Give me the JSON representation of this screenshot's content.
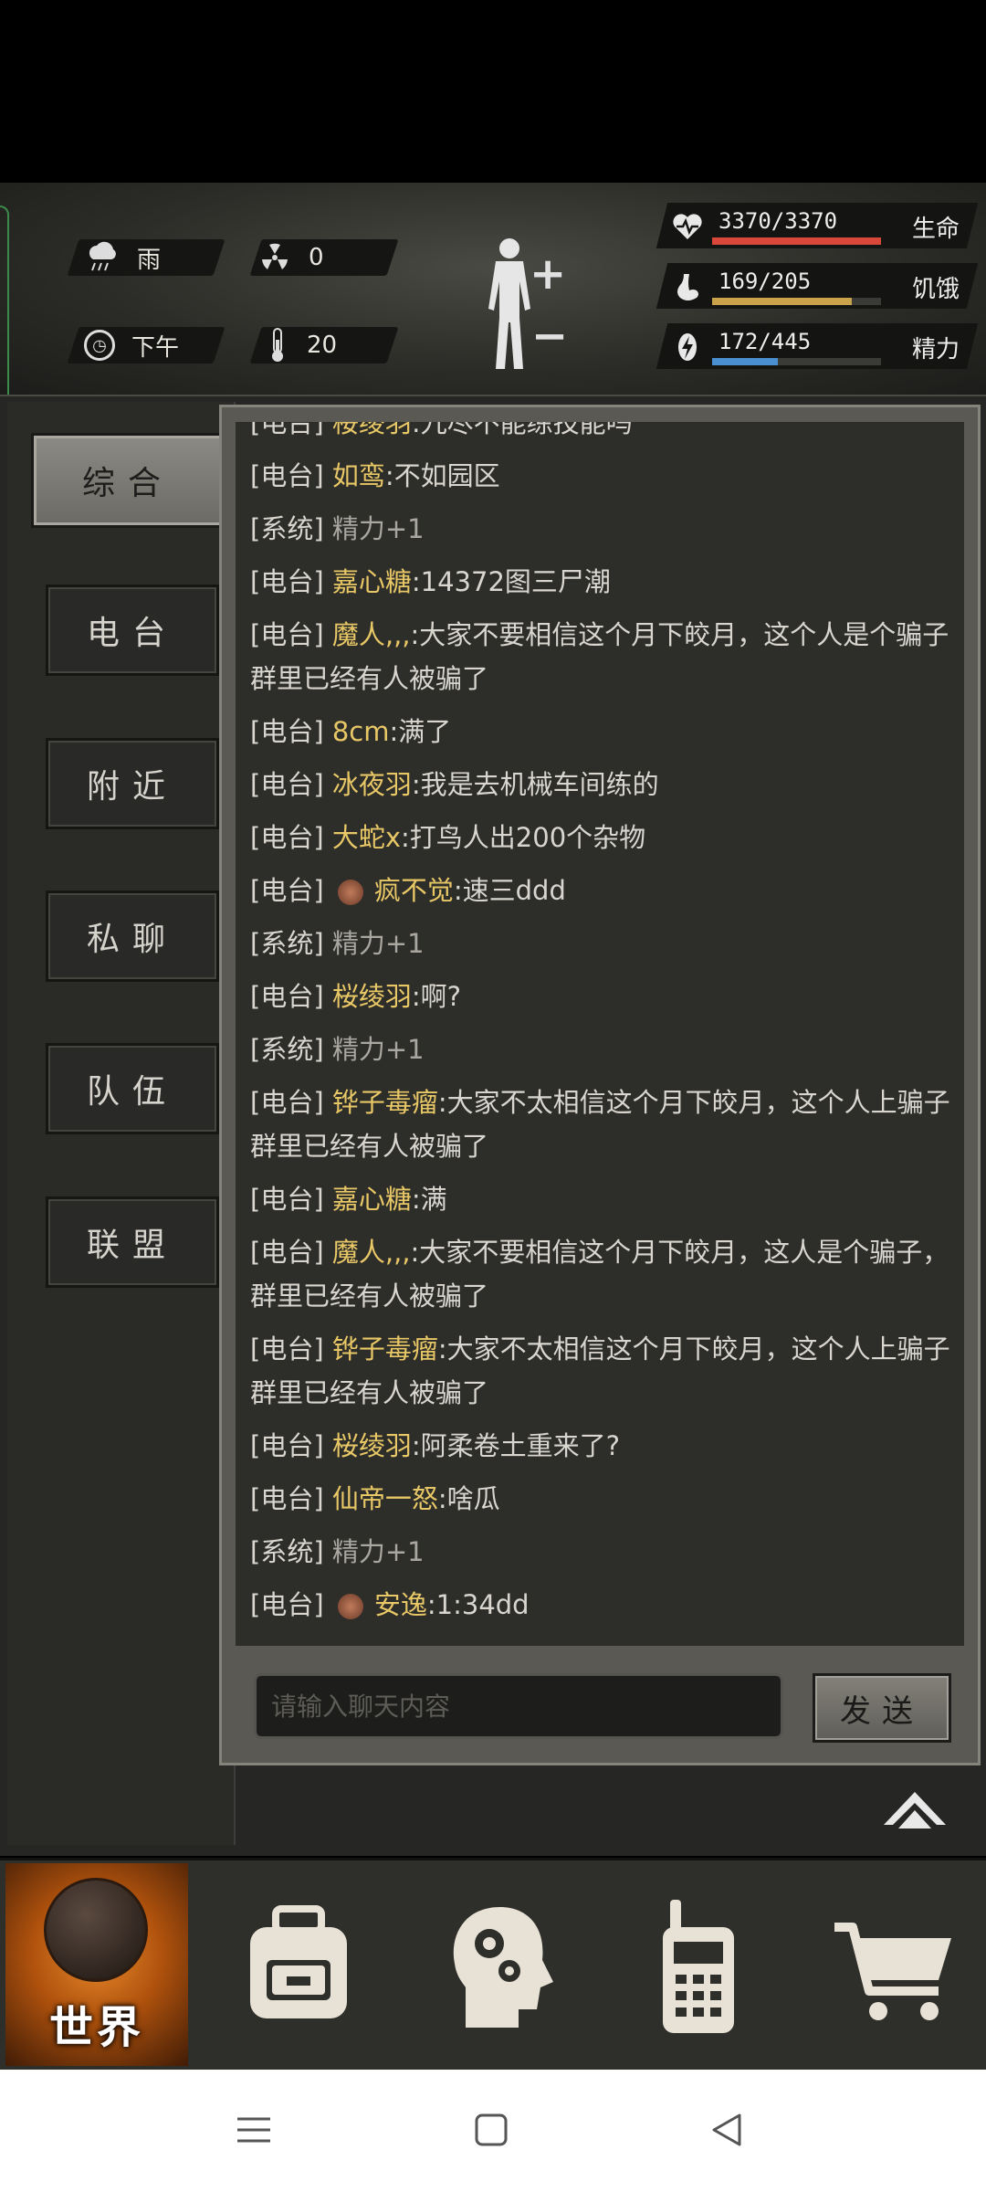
{
  "hud": {
    "weather": {
      "icon": "rain-cloud-icon",
      "label": "雨"
    },
    "radiation": {
      "icon": "radiation-icon",
      "value": "0"
    },
    "time": {
      "icon": "clock-icon",
      "label": "下午"
    },
    "temperature": {
      "icon": "thermometer-icon",
      "value": "20"
    },
    "stats": [
      {
        "name": "生命",
        "value": "3370/3370",
        "current": 3370,
        "max": 3370,
        "color": "#d9473a",
        "icon": "heart-pulse-icon"
      },
      {
        "name": "饥饿",
        "value": "169/205",
        "current": 169,
        "max": 205,
        "color": "#c9a24a",
        "icon": "stomach-icon"
      },
      {
        "name": "精力",
        "value": "172/445",
        "current": 172,
        "max": 445,
        "color": "#4a8fd0",
        "icon": "energy-bolt-icon"
      }
    ]
  },
  "tabs": [
    "综合",
    "电台",
    "附近",
    "私聊",
    "队伍",
    "联盟"
  ],
  "active_tab": "综合",
  "messages": [
    {
      "tag": "[电台]",
      "name": "桜绫羽",
      "text": ":九尽不能练技能吗"
    },
    {
      "tag": "[电台]",
      "name": "如鸾",
      "text": ":不如园区"
    },
    {
      "tag": "[系统]",
      "name": "",
      "text": "精力+1",
      "system": true
    },
    {
      "tag": "[电台]",
      "name": "嘉心糖",
      "text": ":14372图三尸潮"
    },
    {
      "tag": "[电台]",
      "name": "魔人,,,",
      "text": ":大家不要相信这个月下皎月，这个人是个骗子群里已经有人被骗了"
    },
    {
      "tag": "[电台]",
      "name": "8cm",
      "text": ":满了"
    },
    {
      "tag": "[电台]",
      "name": "冰夜羽",
      "text": ":我是去机械车间练的"
    },
    {
      "tag": "[电台]",
      "name": "大蛇x",
      "text": ":打鸟人出200个杂物"
    },
    {
      "tag": "[电台]",
      "name": "疯不觉",
      "text": ":速三ddd",
      "avatar": true
    },
    {
      "tag": "[系统]",
      "name": "",
      "text": "精力+1",
      "system": true
    },
    {
      "tag": "[电台]",
      "name": "桜绫羽",
      "text": ":啊?"
    },
    {
      "tag": "[系统]",
      "name": "",
      "text": "精力+1",
      "system": true
    },
    {
      "tag": "[电台]",
      "name": "铧子毒瘤",
      "text": ":大家不太相信这个月下皎月，这个人上骗子群里已经有人被骗了"
    },
    {
      "tag": "[电台]",
      "name": "嘉心糖",
      "text": ":满"
    },
    {
      "tag": "[电台]",
      "name": "魔人,,,",
      "text": ":大家不要相信这个月下皎月，这人是个骗子，群里已经有人被骗了"
    },
    {
      "tag": "[电台]",
      "name": "铧子毒瘤",
      "text": ":大家不太相信这个月下皎月，这个人上骗子群里已经有人被骗了"
    },
    {
      "tag": "[电台]",
      "name": "桜绫羽",
      "text": ":阿柔卷土重来了?"
    },
    {
      "tag": "[电台]",
      "name": "仙帝一怒",
      "text": ":啥瓜"
    },
    {
      "tag": "[系统]",
      "name": "",
      "text": "精力+1",
      "system": true
    },
    {
      "tag": "[电台]",
      "name": "安逸",
      "text": ":1:34dd",
      "avatar": true
    }
  ],
  "input": {
    "placeholder": "请输入聊天内容",
    "value": ""
  },
  "send_label": "发送",
  "bottom_nav": {
    "world_label": "世界",
    "items": [
      "backpack-icon",
      "brain-skills-icon",
      "radio-walkie-icon",
      "shopping-cart-icon"
    ]
  }
}
